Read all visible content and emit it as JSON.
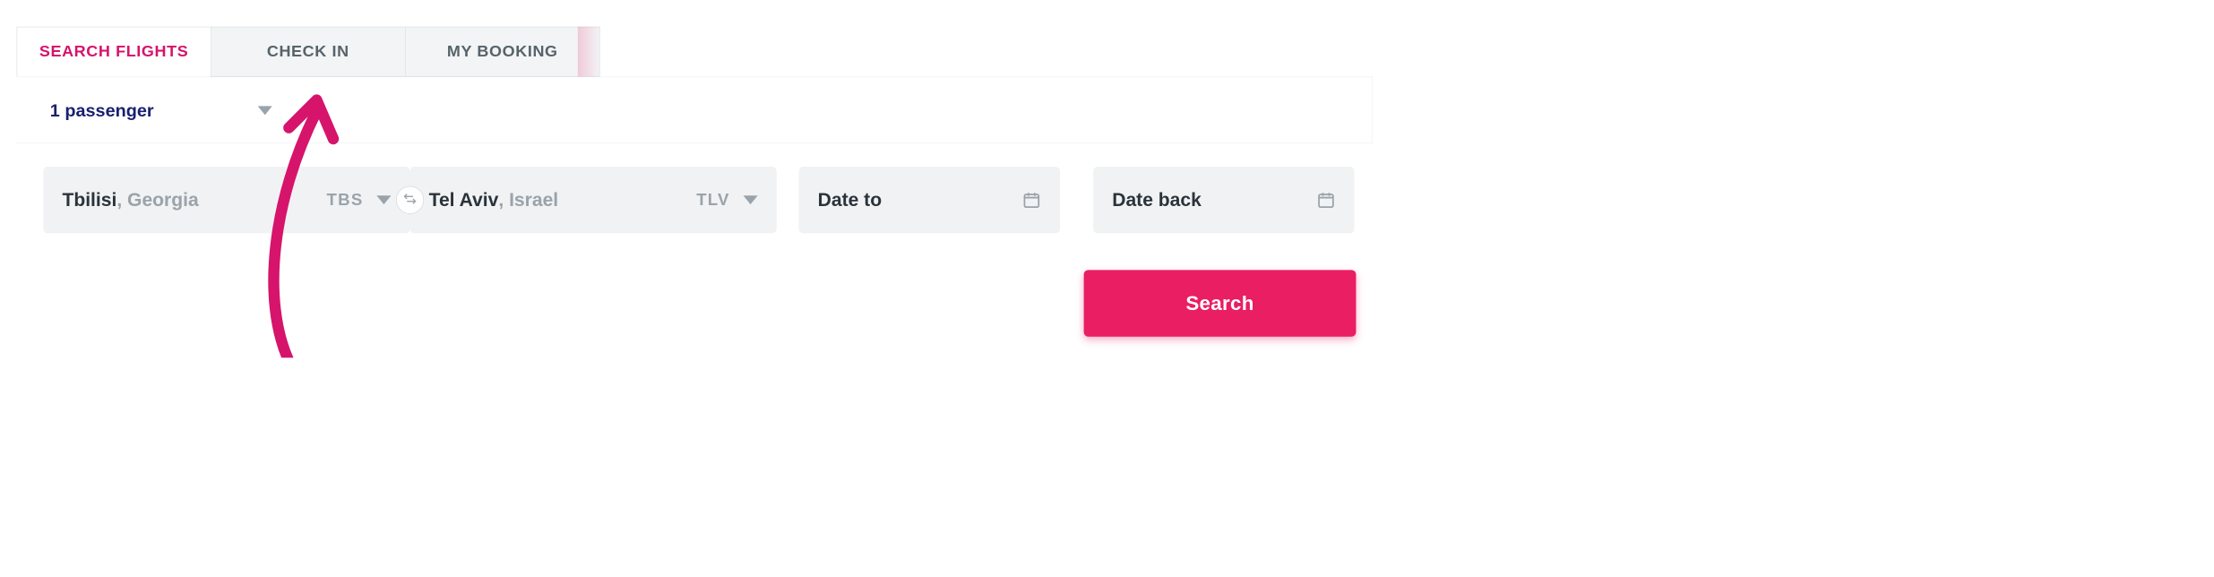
{
  "tabs": {
    "search_flights": "Search Flights",
    "check_in": "Check In",
    "my_booking": "My Booking"
  },
  "passenger": {
    "label": "1 passenger"
  },
  "origin": {
    "city": "Tbilisi",
    "country": ", Georgia",
    "code": "TBS"
  },
  "destination": {
    "city": "Tel Aviv",
    "country": ", Israel",
    "code": "TLV"
  },
  "dates": {
    "to": "Date to",
    "back": "Date back"
  },
  "actions": {
    "search": "Search"
  }
}
